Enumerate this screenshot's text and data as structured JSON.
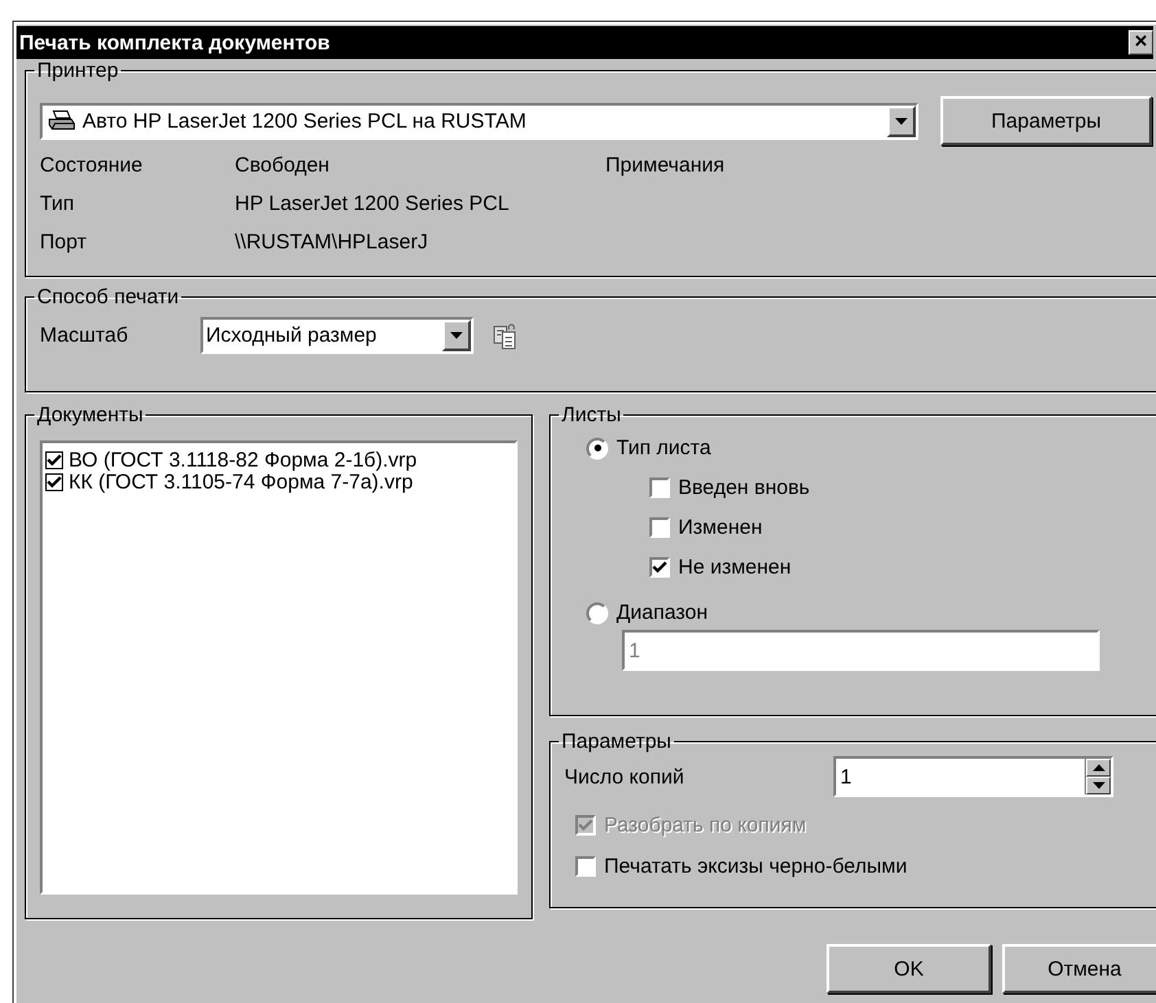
{
  "window": {
    "title": "Печать комплекта документов",
    "close": "×"
  },
  "printer": {
    "title": "Принтер",
    "selected_printer": "Авто HP LaserJet 1200 Series PCL на RUSTAM",
    "properties_button": "Параметры",
    "comments_label": "Примечания",
    "info": [
      {
        "label": "Состояние",
        "value": "Свободен"
      },
      {
        "label": "Тип",
        "value": "HP LaserJet 1200 Series PCL"
      },
      {
        "label": "Порт",
        "value": "\\\\RUSTAM\\HPLaserJ"
      }
    ]
  },
  "print_method": {
    "title": "Способ печати",
    "scale_label": "Масштаб",
    "scale_value": "Исходный размер"
  },
  "documents": {
    "title": "Документы",
    "items": [
      {
        "label": "ВО (ГОСТ 3.1118-82 Форма 2-1б).vrp",
        "checked": true
      },
      {
        "label": "КК (ГОСТ 3.1105-74 Форма 7-7а).vrp",
        "checked": true
      }
    ]
  },
  "sheets": {
    "title": "Листы",
    "sheet_type": {
      "label": "Тип листа",
      "selected": true
    },
    "sheet_type_options": [
      {
        "label": "Введен вновь",
        "checked": false
      },
      {
        "label": "Изменен",
        "checked": false
      },
      {
        "label": "Не изменен",
        "checked": true
      }
    ],
    "range": {
      "label": "Диапазон",
      "selected": false,
      "value": "1",
      "disabled": true
    }
  },
  "parameters": {
    "title": "Параметры",
    "copies_label": "Число копий",
    "copies_value": "1",
    "options": [
      {
        "label": "Разобрать по копиям",
        "checked": true,
        "disabled": true
      },
      {
        "label": "Печатать эксизы черно-белыми",
        "checked": false,
        "disabled": false
      }
    ]
  },
  "buttons": [
    "OK",
    "Отмена"
  ]
}
